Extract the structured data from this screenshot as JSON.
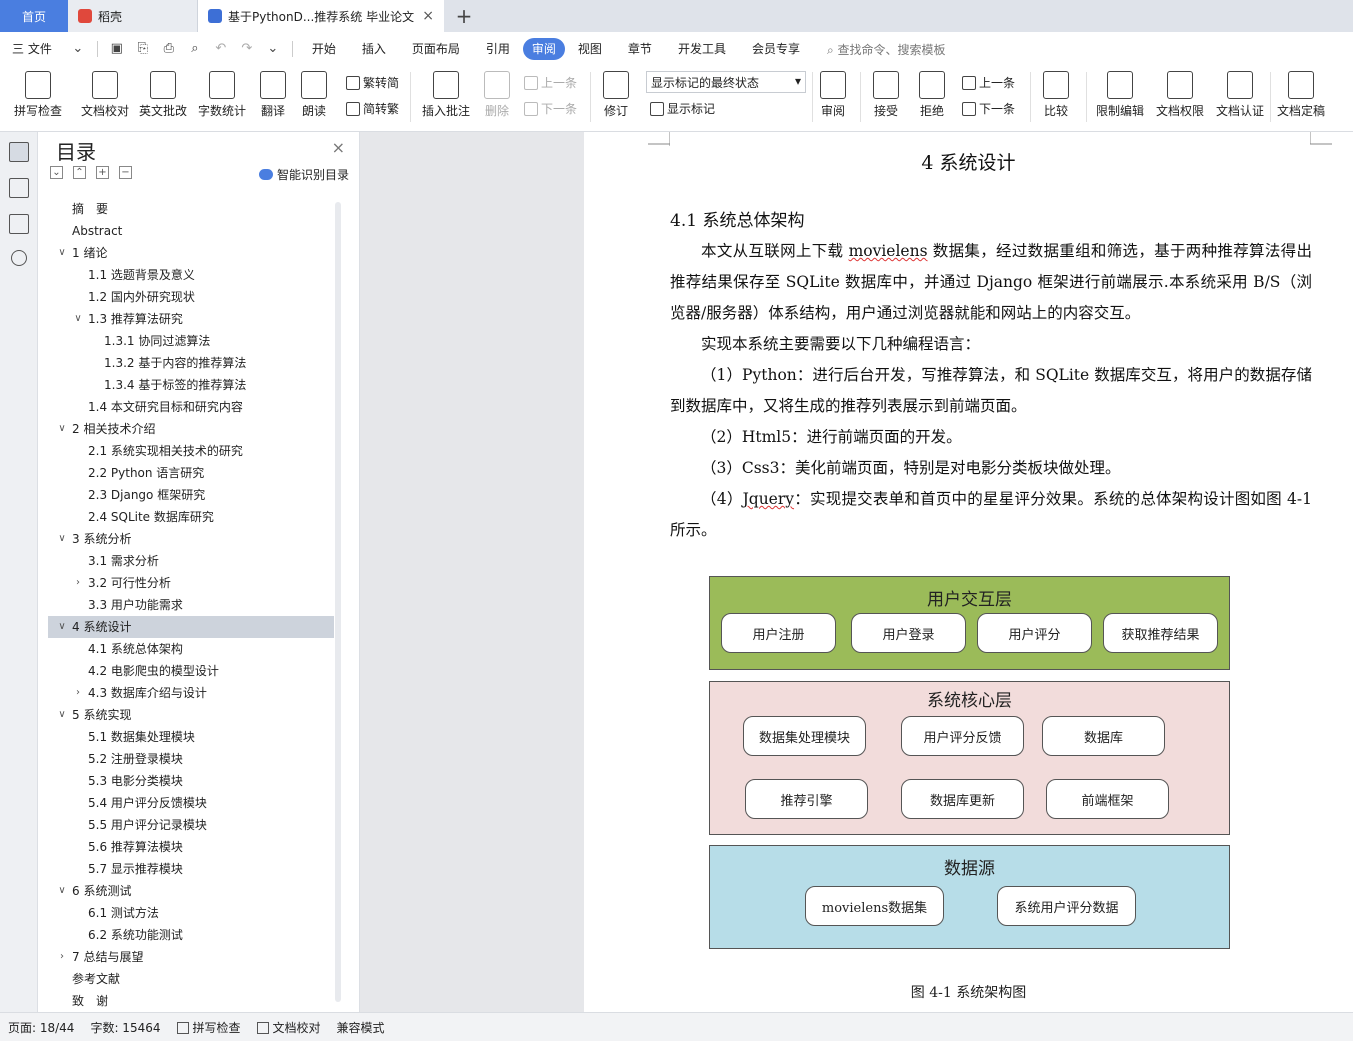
{
  "tabs": {
    "home": "首页",
    "daoke": "稻壳",
    "doc": "基于PythonD...推荐系统 毕业论文",
    "add": "+"
  },
  "menu": {
    "file": "三 文件",
    "items": [
      "开始",
      "插入",
      "页面布局",
      "引用",
      "审阅",
      "视图",
      "章节",
      "开发工具",
      "会员专享"
    ],
    "active_index": 4,
    "search": "查找命令、搜索模板"
  },
  "ribbon": {
    "spell": "拼写检查",
    "proof": "文档校对",
    "eng": "英文批改",
    "wordcount": "字数统计",
    "translate": "翻译",
    "read": "朗读",
    "trad": "繁转简",
    "simp": "简转繁",
    "insert_comment": "插入批注",
    "delete": "删除",
    "prev_comment": "上一条",
    "next_comment": "下一条",
    "revise": "修订",
    "markup_select": "显示标记的最终状态",
    "show_markup": "显示标记",
    "review": "审阅",
    "accept": "接受",
    "reject": "拒绝",
    "prev": "上一条",
    "next": "下一条",
    "compare": "比较",
    "restrict": "限制编辑",
    "rights": "文档权限",
    "cert": "文档认证",
    "final": "文档定稿"
  },
  "toc": {
    "title": "目录",
    "smart": "智能识别目录",
    "items": [
      {
        "label": "摘　要",
        "level": 0,
        "arrow": ""
      },
      {
        "label": "Abstract",
        "level": 0,
        "arrow": ""
      },
      {
        "label": "1 绪论",
        "level": 0,
        "arrow": "v"
      },
      {
        "label": "1.1 选题背景及意义",
        "level": 1,
        "arrow": ""
      },
      {
        "label": "1.2 国内外研究现状",
        "level": 1,
        "arrow": ""
      },
      {
        "label": "1.3 推荐算法研究",
        "level": 1,
        "arrow": "v"
      },
      {
        "label": "1.3.1 协同过滤算法",
        "level": 2,
        "arrow": ""
      },
      {
        "label": "1.3.2 基于内容的推荐算法",
        "level": 2,
        "arrow": ""
      },
      {
        "label": "1.3.4 基于标签的推荐算法",
        "level": 2,
        "arrow": ""
      },
      {
        "label": "1.4 本文研究目标和研究内容",
        "level": 1,
        "arrow": ""
      },
      {
        "label": "2 相关技术介绍",
        "level": 0,
        "arrow": "v"
      },
      {
        "label": "2.1 系统实现相关技术的研究",
        "level": 1,
        "arrow": ""
      },
      {
        "label": "2.2 Python 语言研究",
        "level": 1,
        "arrow": ""
      },
      {
        "label": "2.3 Django 框架研究",
        "level": 1,
        "arrow": ""
      },
      {
        "label": "2.4 SQLite 数据库研究",
        "level": 1,
        "arrow": ""
      },
      {
        "label": "3 系统分析",
        "level": 0,
        "arrow": "v"
      },
      {
        "label": "3.1 需求分析",
        "level": 1,
        "arrow": ""
      },
      {
        "label": "3.2 可行性分析",
        "level": 1,
        "arrow": ">"
      },
      {
        "label": "3.3 用户功能需求",
        "level": 1,
        "arrow": ""
      },
      {
        "label": "4 系统设计",
        "level": 0,
        "arrow": "v",
        "selected": true
      },
      {
        "label": "4.1 系统总体架构",
        "level": 1,
        "arrow": ""
      },
      {
        "label": "4.2 电影爬虫的模型设计",
        "level": 1,
        "arrow": ""
      },
      {
        "label": "4.3 数据库介绍与设计",
        "level": 1,
        "arrow": ">"
      },
      {
        "label": "5 系统实现",
        "level": 0,
        "arrow": "v"
      },
      {
        "label": "5.1 数据集处理模块",
        "level": 1,
        "arrow": ""
      },
      {
        "label": "5.2 注册登录模块",
        "level": 1,
        "arrow": ""
      },
      {
        "label": "5.3 电影分类模块",
        "level": 1,
        "arrow": ""
      },
      {
        "label": "5.4 用户评分反馈模块",
        "level": 1,
        "arrow": ""
      },
      {
        "label": "5.5 用户评分记录模块",
        "level": 1,
        "arrow": ""
      },
      {
        "label": "5.6 推荐算法模块",
        "level": 1,
        "arrow": ""
      },
      {
        "label": "5.7 显示推荐模块",
        "level": 1,
        "arrow": ""
      },
      {
        "label": "6 系统测试",
        "level": 0,
        "arrow": "v"
      },
      {
        "label": "6.1 测试方法",
        "level": 1,
        "arrow": ""
      },
      {
        "label": "6.2 系统功能测试",
        "level": 1,
        "arrow": ""
      },
      {
        "label": "7 总结与展望",
        "level": 0,
        "arrow": ">"
      },
      {
        "label": "参考文献",
        "level": 0,
        "arrow": ""
      },
      {
        "label": "致　谢",
        "level": 0,
        "arrow": ""
      }
    ]
  },
  "doc": {
    "h1": "4 系统设计",
    "h2": "4.1 系统总体架构",
    "p1_a": "本文从互联网上下载 ",
    "p1_u": "movielens",
    "p1_b": " 数据集，经过数据重组和筛选，基于两种推荐算法得出推荐结果保存至 SQLite 数据库中，并通过 Django 框架进行前端展示.本系统采用 B/S（浏览器/服务器）体系结构，用户通过浏览器就能和网站上的内容交互。",
    "p2": "实现本系统主要需要以下几种编程语言：",
    "p3": "（1）Python：进行后台开发，写推荐算法，和 SQLite 数据库交互，将用户的数据存储到数据库中，又将生成的推荐列表展示到前端页面。",
    "p4": "（2）Html5：进行前端页面的开发。",
    "p5": "（3）Css3：美化前端页面，特别是对电影分类板块做处理。",
    "p6_a": "（4）",
    "p6_u": "Jquery",
    "p6_b": "：实现提交表单和首页中的星星评分效果。系统的总体架构设计图如图 4-1 所示。",
    "caption": "图 4-1 系统架构图"
  },
  "diagram": {
    "layer1": {
      "title": "用户交互层",
      "color": "#9bbb59",
      "boxes": [
        "用户注册",
        "用户登录",
        "用户评分",
        "获取推荐结果"
      ]
    },
    "layer2": {
      "title": "系统核心层",
      "color": "#f2dcdb",
      "boxes": [
        "数据集处理模块",
        "用户评分反馈",
        "数据库",
        "推荐引擎",
        "数据库更新",
        "前端框架"
      ]
    },
    "layer3": {
      "title": "数据源",
      "color": "#b7dde8",
      "boxes": [
        "movielens数据集",
        "系统用户评分数据"
      ]
    }
  },
  "status": {
    "page": "页面: 18/44",
    "words": "字数: 15464",
    "spell": "拼写检查",
    "proof": "文档校对",
    "compat": "兼容模式"
  }
}
